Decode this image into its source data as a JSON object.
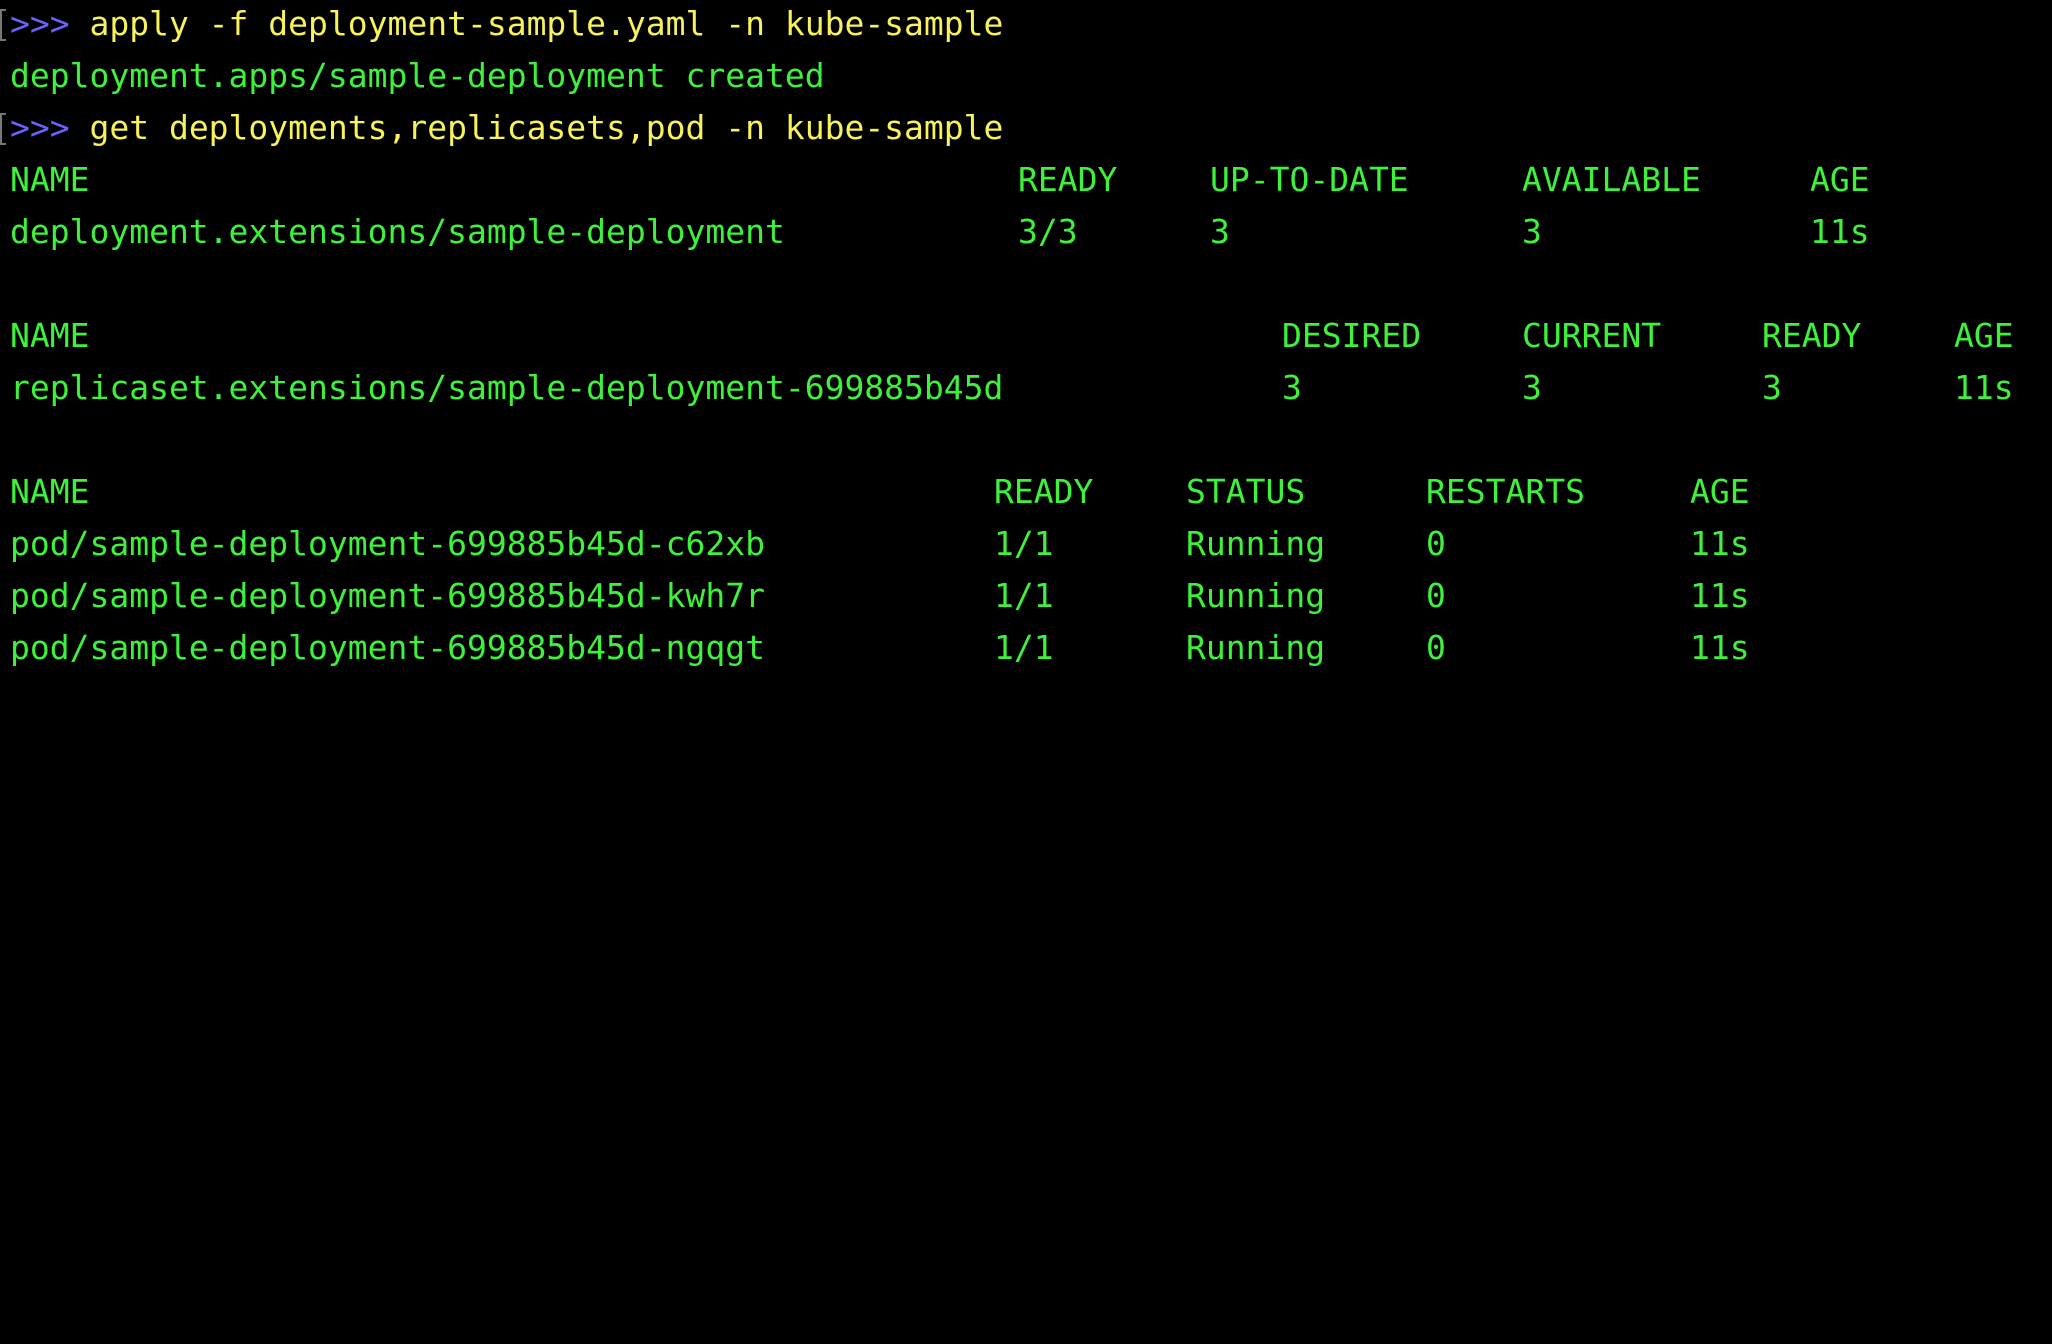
{
  "terminal": {
    "colors": {
      "background": "#000000",
      "prompt": "#6a62ff",
      "command": "#f7f25a",
      "output": "#3ef23c"
    },
    "commands": [
      {
        "prompt": ">>>",
        "text": " apply -f deployment-sample.yaml -n kube-sample",
        "output": "deployment.apps/sample-deployment created"
      },
      {
        "prompt": ">>>",
        "text": " get deployments,replicasets,pod -n kube-sample"
      }
    ],
    "deployments": {
      "headers": [
        "NAME",
        "READY",
        "UP-TO-DATE",
        "AVAILABLE",
        "AGE"
      ],
      "rows": [
        [
          "deployment.extensions/sample-deployment",
          "3/3",
          "3",
          "3",
          "11s"
        ]
      ]
    },
    "replicasets": {
      "headers": [
        "NAME",
        "DESIRED",
        "CURRENT",
        "READY",
        "AGE"
      ],
      "rows": [
        [
          "replicaset.extensions/sample-deployment-699885b45d",
          "3",
          "3",
          "3",
          "11s"
        ]
      ]
    },
    "pods": {
      "headers": [
        "NAME",
        "READY",
        "STATUS",
        "RESTARTS",
        "AGE"
      ],
      "rows": [
        [
          "pod/sample-deployment-699885b45d-c62xb",
          "1/1",
          "Running",
          "0",
          "11s"
        ],
        [
          "pod/sample-deployment-699885b45d-kwh7r",
          "1/1",
          "Running",
          "0",
          "11s"
        ],
        [
          "pod/sample-deployment-699885b45d-ngqgt",
          "1/1",
          "Running",
          "0",
          "11s"
        ]
      ]
    }
  }
}
